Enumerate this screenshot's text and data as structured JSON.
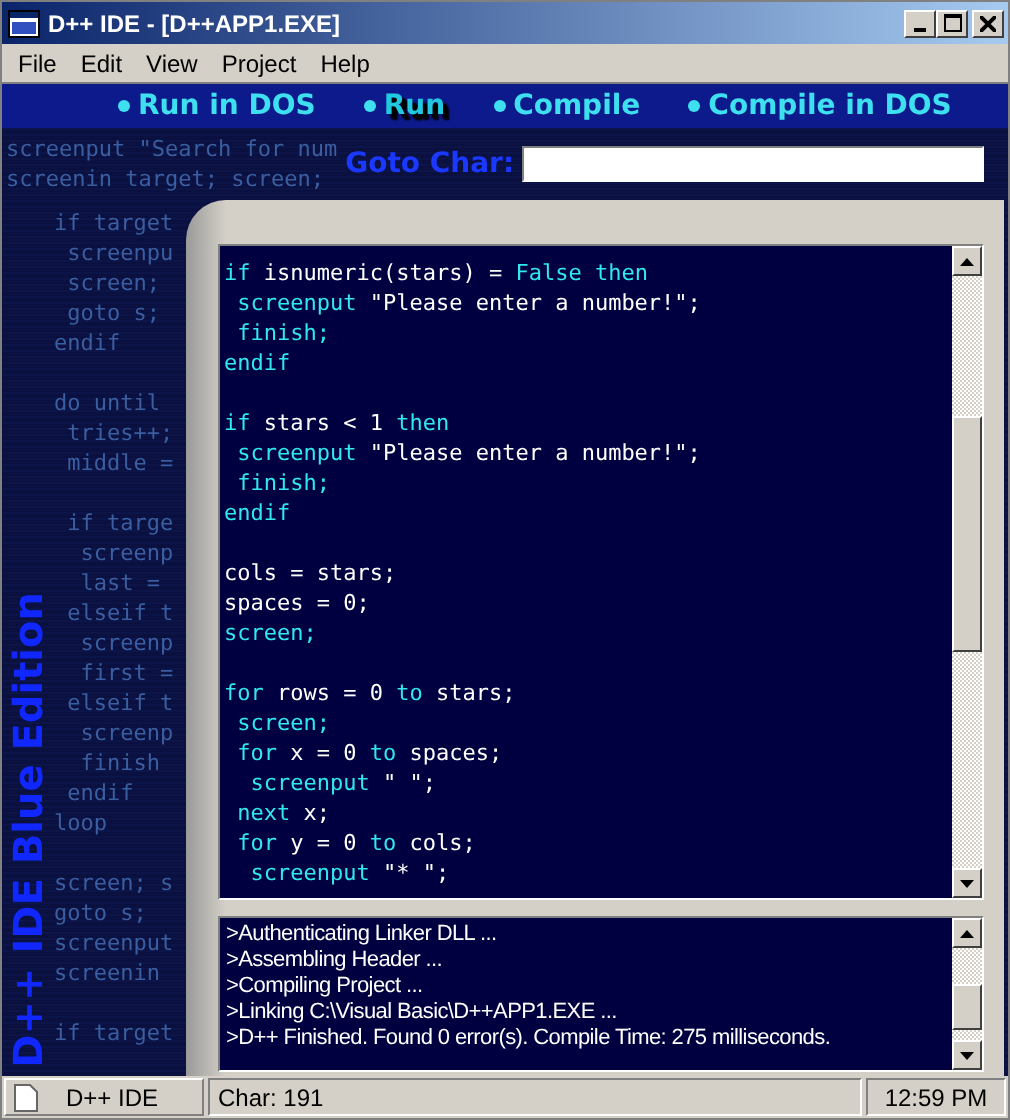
{
  "window": {
    "title": "D++ IDE - [D++APP1.EXE]"
  },
  "menu": [
    "File",
    "Edit",
    "View",
    "Project",
    "Help"
  ],
  "toolbar": [
    {
      "label": "Run in DOS",
      "selected": false
    },
    {
      "label": "Run",
      "selected": true
    },
    {
      "label": "Compile",
      "selected": false
    },
    {
      "label": "Compile in DOS",
      "selected": false
    }
  ],
  "background_code": {
    "top_lines": [
      "screenput \"Search for num",
      "screenin target; screen;"
    ],
    "side_blocks": [
      [
        "if target",
        " screenpu",
        " screen;",
        " goto s;",
        "endif"
      ],
      [
        "do until",
        " tries++;",
        " middle ="
      ],
      [
        " if targe",
        "  screenp",
        "  last =",
        " elseif t",
        "  screenp",
        "  first =",
        " elseif t",
        "  screenp",
        "  finish",
        " endif",
        "loop"
      ],
      [
        "screen; s",
        "goto s;",
        "screenput",
        "screenin"
      ],
      [
        "if target"
      ]
    ],
    "vertical_title": "D++ IDE Blue Edition"
  },
  "goto": {
    "label": "Goto Char:"
  },
  "editor": {
    "blocks": [
      [
        [
          {
            "text": "if ",
            "keyword": true
          },
          {
            "text": "isnumeric(stars) = ",
            "keyword": false
          },
          {
            "text": "False then",
            "keyword": true
          }
        ],
        [
          {
            "text": " screenput ",
            "keyword": true
          },
          {
            "text": "\"Please enter a number!\";",
            "keyword": false
          }
        ],
        [
          {
            "text": " finish;",
            "keyword": true
          }
        ],
        [
          {
            "text": "endif",
            "keyword": true
          }
        ]
      ],
      [
        [
          {
            "text": "if ",
            "keyword": true
          },
          {
            "text": "stars < 1 ",
            "keyword": false
          },
          {
            "text": "then",
            "keyword": true
          }
        ],
        [
          {
            "text": " screenput ",
            "keyword": true
          },
          {
            "text": "\"Please enter a number!\";",
            "keyword": false
          }
        ],
        [
          {
            "text": " finish;",
            "keyword": true
          }
        ],
        [
          {
            "text": "endif",
            "keyword": true
          }
        ]
      ],
      [
        [
          {
            "text": "cols = stars;",
            "keyword": false
          }
        ],
        [
          {
            "text": "spaces = 0;",
            "keyword": false
          }
        ],
        [
          {
            "text": "screen;",
            "keyword": true
          }
        ]
      ],
      [
        [
          {
            "text": "for ",
            "keyword": true
          },
          {
            "text": "rows = 0 ",
            "keyword": false
          },
          {
            "text": "to ",
            "keyword": true
          },
          {
            "text": "stars;",
            "keyword": false
          }
        ],
        [
          {
            "text": " screen;",
            "keyword": true
          }
        ],
        [
          {
            "text": " for ",
            "keyword": true
          },
          {
            "text": "x = 0 ",
            "keyword": false
          },
          {
            "text": "to ",
            "keyword": true
          },
          {
            "text": "spaces;",
            "keyword": false
          }
        ],
        [
          {
            "text": "  screenput ",
            "keyword": true
          },
          {
            "text": "\" \";",
            "keyword": false
          }
        ],
        [
          {
            "text": " next ",
            "keyword": true
          },
          {
            "text": "x;",
            "keyword": false
          }
        ],
        [
          {
            "text": " for ",
            "keyword": true
          },
          {
            "text": "y = 0 ",
            "keyword": false
          },
          {
            "text": "to ",
            "keyword": true
          },
          {
            "text": "cols;",
            "keyword": false
          }
        ],
        [
          {
            "text": "  screenput ",
            "keyword": true
          },
          {
            "text": "\"* \";",
            "keyword": false
          }
        ]
      ]
    ]
  },
  "output": {
    "lines": [
      ">Authenticating Linker DLL ...",
      ">Assembling Header ...",
      ">Compiling Project ...",
      ">Linking C:\\Visual Basic\\D++APP1.EXE ...",
      ">D++ Finished. Found 0 error(s). Compile Time: 275 milliseconds."
    ]
  },
  "status_bar": {
    "app": "D++ IDE",
    "position": "Char: 191",
    "clock": "12:59 PM"
  }
}
